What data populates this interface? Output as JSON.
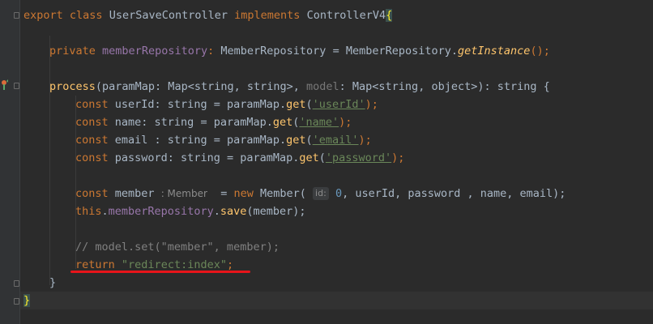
{
  "code": {
    "l1": {
      "kw_export": "export",
      "kw_class": "class",
      "class_name": "UserSaveController",
      "kw_implements": "implements",
      "iface": "ControllerV4",
      "brace": "{"
    },
    "l2": {
      "kw_private": "private",
      "field": "memberRepository",
      "colon": ":",
      "type": "MemberRepository",
      "eq": "=",
      "cls": "MemberRepository",
      "dot": ".",
      "method": "getInstance",
      "tail": "();"
    },
    "l3": {
      "fn": "process",
      "params": "(paramMap: Map<string, string>,",
      "param2": "model",
      "params2": ": Map<string, object>): string {"
    },
    "l4": {
      "kw": "const",
      "decl": "userId: string = paramMap.",
      "get": "get",
      "open": "(",
      "str": "'userId'",
      "close": ");"
    },
    "l5": {
      "kw": "const",
      "decl": "name: string = paramMap.",
      "get": "get",
      "open": "(",
      "str": "'name'",
      "close": ");"
    },
    "l6": {
      "kw": "const",
      "decl": "email : string = paramMap.",
      "get": "get",
      "open": "(",
      "str": "'email'",
      "close": ");"
    },
    "l7": {
      "kw": "const",
      "decl": "password: string = paramMap.",
      "get": "get",
      "open": "(",
      "str": "'password'",
      "close": ");"
    },
    "l8": {
      "kw": "const",
      "name": "member",
      "type_hint": ": Member",
      "eq": "=",
      "kw_new": "new",
      "cls": "Member(",
      "param_hint": "id:",
      "num": "0",
      "rest": ", userId, password , name, email);"
    },
    "l9": {
      "kw_this": "this",
      "dot": ".",
      "field": "memberRepository",
      "dot2": ".",
      "method": "save",
      "args": "(member);"
    },
    "l10": {
      "comment": "// model.set(\"member\", member);"
    },
    "l11": {
      "kw_return": "return",
      "str": "\"redirect:index\"",
      "semi": ";"
    },
    "l12": {
      "brace": "}"
    },
    "l13": {
      "brace": "}"
    }
  },
  "colors": {
    "background": "#2b2b2b",
    "keyword": "#cc7832",
    "function": "#ffc66d",
    "field": "#9876aa",
    "string": "#6a8759",
    "comment": "#808080",
    "number": "#6897bb",
    "error_underline": "#e8141a"
  }
}
